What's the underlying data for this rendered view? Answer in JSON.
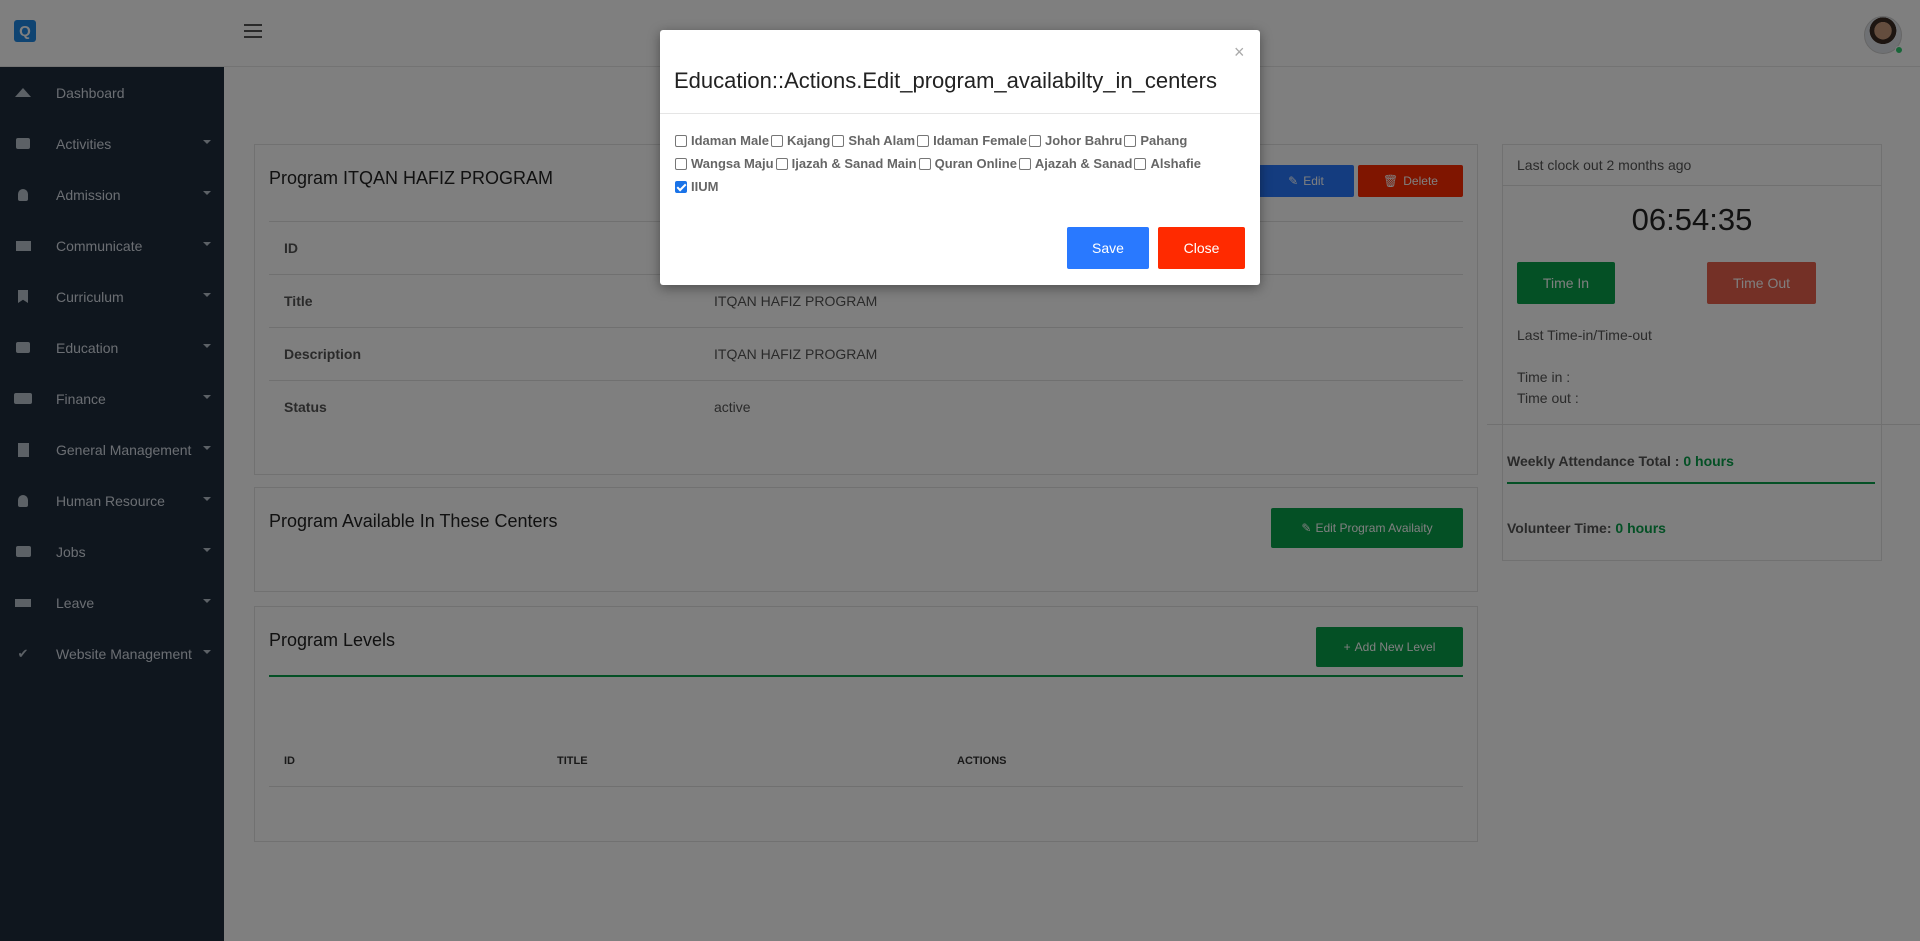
{
  "topbar": {
    "logo_text": "Q",
    "menu_icon": "hamburger-menu-icon",
    "avatar_icon": "user-avatar"
  },
  "sidebar": {
    "items": [
      {
        "label": "Dashboard",
        "icon": "dashboard-icon"
      },
      {
        "label": "Activities",
        "icon": "book-icon"
      },
      {
        "label": "Admission",
        "icon": "user-icon"
      },
      {
        "label": "Communicate",
        "icon": "envelope-icon"
      },
      {
        "label": "Curriculum",
        "icon": "bookmark-icon"
      },
      {
        "label": "Education",
        "icon": "book-icon"
      },
      {
        "label": "Finance",
        "icon": "money-icon"
      },
      {
        "label": "General Management",
        "icon": "building-icon"
      },
      {
        "label": "Human Resource",
        "icon": "user-icon"
      },
      {
        "label": "Jobs",
        "icon": "briefcase-icon"
      },
      {
        "label": "Leave",
        "icon": "bed-icon"
      },
      {
        "label": "Website Management",
        "icon": "check-icon"
      }
    ]
  },
  "program": {
    "title": "Program ITQAN HAFIZ PROGRAM",
    "edit_label": "Edit",
    "delete_label": "Delete",
    "rows": [
      {
        "label": "ID",
        "value": ""
      },
      {
        "label": "Title",
        "value": "ITQAN HAFIZ PROGRAM"
      },
      {
        "label": "Description",
        "value": "ITQAN HAFIZ PROGRAM"
      },
      {
        "label": "Status",
        "value": "active"
      }
    ]
  },
  "centers": {
    "title": "Program Available In These Centers",
    "edit_availability_label": "Edit Program Availaity"
  },
  "levels": {
    "title": "Program Levels",
    "add_level_label": "Add New Level",
    "columns": [
      "ID",
      "TITLE",
      "ACTIONS"
    ]
  },
  "clock": {
    "last_clock_out": "Last clock out 2 months ago",
    "time": "06:54:35",
    "time_in_label": "Time In",
    "time_out_label": "Time Out",
    "last_title": "Last Time-in/Time-out",
    "time_in_text": "Time in :",
    "time_out_text": "Time out :",
    "weekly_label": "Weekly Attendance Total :",
    "weekly_value": "0 hours",
    "volunteer_label": "Volunteer Time:",
    "volunteer_value": "0 hours"
  },
  "modal": {
    "close_x": "×",
    "title": "Education::Actions.Edit_program_availabilty_in_centers",
    "centers": [
      {
        "label": "Idaman Male",
        "checked": false
      },
      {
        "label": "Kajang",
        "checked": false
      },
      {
        "label": "Shah Alam",
        "checked": false
      },
      {
        "label": "Idaman Female",
        "checked": false
      },
      {
        "label": "Johor Bahru",
        "checked": false
      },
      {
        "label": "Pahang",
        "checked": false
      },
      {
        "label": "Wangsa Maju",
        "checked": false
      },
      {
        "label": "Ijazah & Sanad Main",
        "checked": false
      },
      {
        "label": "Quran Online",
        "checked": false
      },
      {
        "label": "Ajazah & Sanad",
        "checked": false
      },
      {
        "label": "Alshafie",
        "checked": false
      },
      {
        "label": "IIUM",
        "checked": true
      }
    ],
    "save_label": "Save",
    "close_label": "Close"
  },
  "colors": {
    "sidebar_bg": "#1f2d3d",
    "primary": "#2979ff",
    "danger": "#ff2a00",
    "success": "#08a04b",
    "time_out": "#e8604c"
  }
}
